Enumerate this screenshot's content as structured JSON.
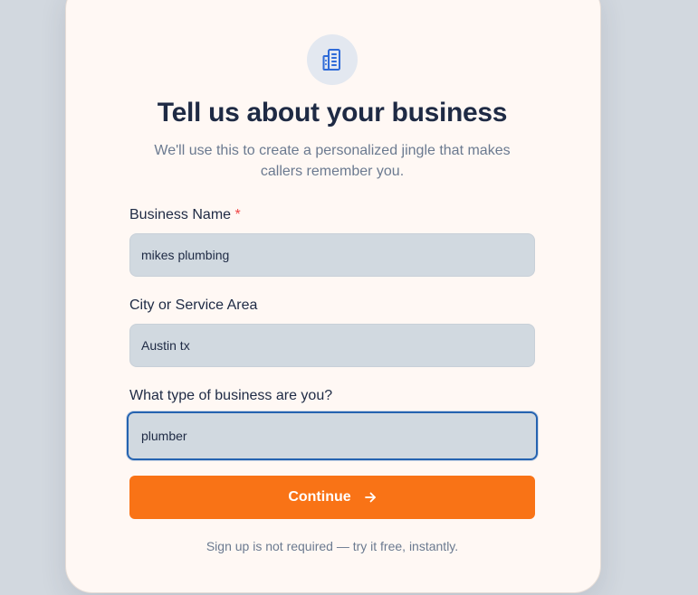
{
  "header": {
    "icon": "building-icon",
    "title": "Tell us about your business",
    "subtitle": "We'll use this to create a personalized jingle that makes callers remember you."
  },
  "form": {
    "business_name": {
      "label": "Business Name",
      "required_mark": "*",
      "value": "mikes plumbing"
    },
    "city": {
      "label": "City or Service Area",
      "value": "Austin tx"
    },
    "business_type": {
      "label": "What type of business are you?",
      "value": "plumber"
    },
    "continue_label": "Continue",
    "continue_icon": "arrow-right-icon"
  },
  "footer": {
    "note": "Sign up is not required — try it free, instantly."
  },
  "colors": {
    "accent": "#f97316",
    "focus_border": "#2563b0",
    "icon_blue": "#2f6bd8",
    "title": "#1e2a44",
    "muted": "#6b7a90",
    "required": "#ef4444"
  }
}
